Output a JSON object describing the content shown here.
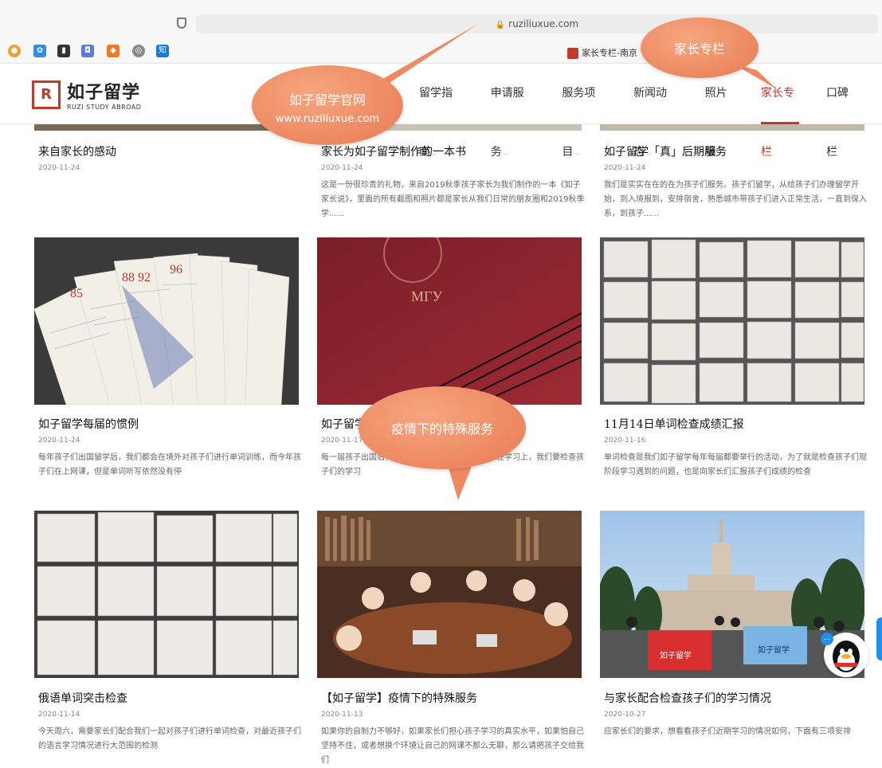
{
  "browser": {
    "url": "ruziliuxue.com",
    "tab_title": "家长专栏-南京"
  },
  "logo": {
    "mark": "R",
    "name_cn": "如子留学",
    "name_en": "RUZI STUDY ABROAD"
  },
  "nav": {
    "items": [
      {
        "label": "留学指南",
        "dropdown": true
      },
      {
        "label": "申请服务",
        "dropdown": true
      },
      {
        "label": "服务项目",
        "dropdown": true
      },
      {
        "label": "新闻动态",
        "dropdown": true
      },
      {
        "label": "照片墙",
        "dropdown": false
      },
      {
        "label": "家长专栏",
        "dropdown": false,
        "active": true
      },
      {
        "label": "口碑栏",
        "dropdown": false
      }
    ]
  },
  "annotations": {
    "official_site_title": "如子留学官网",
    "official_site_url": "www.ruziliuxue.com",
    "parent_column": "家长专栏",
    "special_service": "疫情下的特殊服务"
  },
  "articles": [
    {
      "title": "来自家长的感动",
      "date": "2020-11-24",
      "summary": ""
    },
    {
      "title": "家长为如子留学制作的一本书",
      "date": "2020-11-24",
      "summary": "这是一份很珍贵的礼物，来自2019秋季孩子家长为我们制作的一本《如子家长说》，里面的所有截图和照片都是家长从我们日常的朋友圈和2019秋季学......"
    },
    {
      "title": "如子留学「真」后期服务",
      "date": "2020-11-24",
      "summary": "我们是实实在在的在为孩子们服务。孩子们留学，从给孩子们办理留学开始，到入境报到，安排宿舍，熟悉城市带孩子们进入正常生活，一直到保入系，到孩子......"
    },
    {
      "title": "如子留学每届的惯例",
      "date": "2020-11-24",
      "summary": "每年孩子们出国留学后，我们都会在境外对孩子们进行单词训练，而今年孩子们在上网课，但是单词听写依然没有停"
    },
    {
      "title": "如子留学",
      "date": "2020-11-17",
      "summary": "每一届孩子出国后，我们都会提供境外服务，其中在学习上，我们要检查孩子们的学习"
    },
    {
      "title": "11月14日单词检查成绩汇报",
      "date": "2020-11-16",
      "summary": "单词检查是我们如子留学每年每届都要举行的活动，为了就是检查孩子们现阶段学习遇到的问题，也是向家长们汇报孩子们成绩的检查"
    },
    {
      "title": "俄语单词突击检查",
      "date": "2020-11-14",
      "summary": "今天周六，需要家长们配合我们一起对孩子们进行单词检查，对最近孩子们的语言学习情况进行大范围的检测"
    },
    {
      "title": "【如子留学】疫情下的特殊服务",
      "date": "2020-11-13",
      "summary": "如果你的自制力不够好，如果家长们担心孩子学习的真实水平，如果怕自己坚持不住，或者想换个环境让自己的网课不那么无聊，那么请把孩子交给我们"
    },
    {
      "title": "与家长配合检查孩子们的学习情况",
      "date": "2020-10-27",
      "summary": "应家长们的要求，想看看孩子们近期学习的情况如何，下面有三项安排"
    }
  ],
  "images": {
    "diploma_text": "МГУ",
    "banner_left": "如子留学",
    "banner_right": "如子留学"
  },
  "colors": {
    "brand": "#c0392b",
    "callout": "#ee8a62",
    "qq": "#1f8ff0"
  }
}
